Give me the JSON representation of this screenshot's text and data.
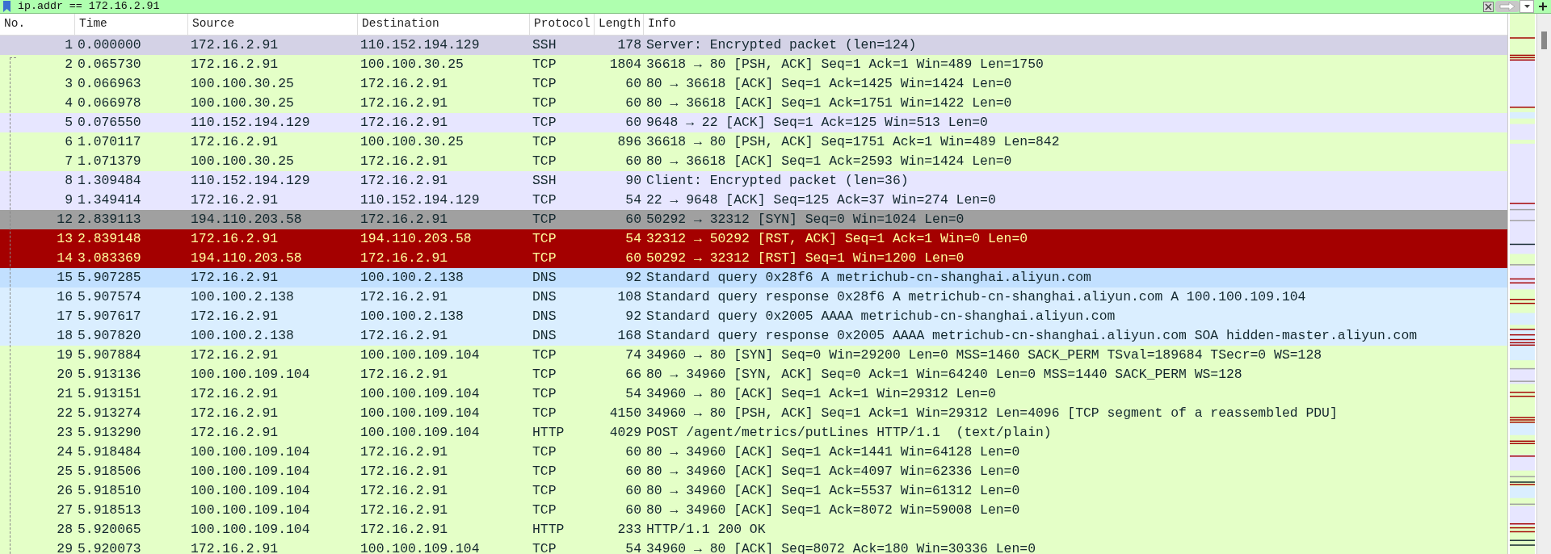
{
  "filter": {
    "value": "ip.addr == 172.16.2.91"
  },
  "columns": [
    "No.",
    "Time",
    "Source",
    "Destination",
    "Protocol",
    "Length",
    "Info"
  ],
  "packets": [
    {
      "no": "1",
      "time": "0.000000",
      "source": "172.16.2.91",
      "destination": "110.152.194.129",
      "protocol": "SSH",
      "length": "178",
      "info": "Server: Encrypted packet (len=124)",
      "kind": "ssh",
      "selected": true,
      "hovered": false
    },
    {
      "no": "2",
      "time": "0.065730",
      "source": "172.16.2.91",
      "destination": "100.100.30.25",
      "protocol": "TCP",
      "length": "1804",
      "info": "36618 → 80 [PSH, ACK] Seq=1 Ack=1 Win=489 Len=1750",
      "kind": "tcp",
      "selected": false,
      "hovered": false
    },
    {
      "no": "3",
      "time": "0.066963",
      "source": "100.100.30.25",
      "destination": "172.16.2.91",
      "protocol": "TCP",
      "length": "60",
      "info": "80 → 36618 [ACK] Seq=1 Ack=1425 Win=1424 Len=0",
      "kind": "tcp",
      "selected": false,
      "hovered": false
    },
    {
      "no": "4",
      "time": "0.066978",
      "source": "100.100.30.25",
      "destination": "172.16.2.91",
      "protocol": "TCP",
      "length": "60",
      "info": "80 → 36618 [ACK] Seq=1 Ack=1751 Win=1422 Len=0",
      "kind": "tcp",
      "selected": false,
      "hovered": false
    },
    {
      "no": "5",
      "time": "0.076550",
      "source": "110.152.194.129",
      "destination": "172.16.2.91",
      "protocol": "TCP",
      "length": "60",
      "info": "9648 → 22 [ACK] Seq=1 Ack=125 Win=513 Len=0",
      "kind": "ssh",
      "selected": false,
      "hovered": false
    },
    {
      "no": "6",
      "time": "1.070117",
      "source": "172.16.2.91",
      "destination": "100.100.30.25",
      "protocol": "TCP",
      "length": "896",
      "info": "36618 → 80 [PSH, ACK] Seq=1751 Ack=1 Win=489 Len=842",
      "kind": "tcp",
      "selected": false,
      "hovered": false
    },
    {
      "no": "7",
      "time": "1.071379",
      "source": "100.100.30.25",
      "destination": "172.16.2.91",
      "protocol": "TCP",
      "length": "60",
      "info": "80 → 36618 [ACK] Seq=1 Ack=2593 Win=1424 Len=0",
      "kind": "tcp",
      "selected": false,
      "hovered": false
    },
    {
      "no": "8",
      "time": "1.309484",
      "source": "110.152.194.129",
      "destination": "172.16.2.91",
      "protocol": "SSH",
      "length": "90",
      "info": "Client: Encrypted packet (len=36)",
      "kind": "ssh",
      "selected": false,
      "hovered": false
    },
    {
      "no": "9",
      "time": "1.349414",
      "source": "172.16.2.91",
      "destination": "110.152.194.129",
      "protocol": "TCP",
      "length": "54",
      "info": "22 → 9648 [ACK] Seq=125 Ack=37 Win=274 Len=0",
      "kind": "ssh",
      "selected": false,
      "hovered": false
    },
    {
      "no": "12",
      "time": "2.839113",
      "source": "194.110.203.58",
      "destination": "172.16.2.91",
      "protocol": "TCP",
      "length": "60",
      "info": "50292 → 32312 [SYN] Seq=0 Win=1024 Len=0",
      "kind": "syn",
      "selected": false,
      "hovered": false
    },
    {
      "no": "13",
      "time": "2.839148",
      "source": "172.16.2.91",
      "destination": "194.110.203.58",
      "protocol": "TCP",
      "length": "54",
      "info": "32312 → 50292 [RST, ACK] Seq=1 Ack=1 Win=0 Len=0",
      "kind": "rst",
      "selected": false,
      "hovered": false
    },
    {
      "no": "14",
      "time": "3.083369",
      "source": "194.110.203.58",
      "destination": "172.16.2.91",
      "protocol": "TCP",
      "length": "60",
      "info": "50292 → 32312 [RST] Seq=1 Win=1200 Len=0",
      "kind": "rst",
      "selected": false,
      "hovered": false
    },
    {
      "no": "15",
      "time": "5.907285",
      "source": "172.16.2.91",
      "destination": "100.100.2.138",
      "protocol": "DNS",
      "length": "92",
      "info": "Standard query 0x28f6 A metrichub-cn-shanghai.aliyun.com",
      "kind": "dns",
      "selected": false,
      "hovered": true
    },
    {
      "no": "16",
      "time": "5.907574",
      "source": "100.100.2.138",
      "destination": "172.16.2.91",
      "protocol": "DNS",
      "length": "108",
      "info": "Standard query response 0x28f6 A metrichub-cn-shanghai.aliyun.com A 100.100.109.104",
      "kind": "dns",
      "selected": false,
      "hovered": false
    },
    {
      "no": "17",
      "time": "5.907617",
      "source": "172.16.2.91",
      "destination": "100.100.2.138",
      "protocol": "DNS",
      "length": "92",
      "info": "Standard query 0x2005 AAAA metrichub-cn-shanghai.aliyun.com",
      "kind": "dns",
      "selected": false,
      "hovered": false
    },
    {
      "no": "18",
      "time": "5.907820",
      "source": "100.100.2.138",
      "destination": "172.16.2.91",
      "protocol": "DNS",
      "length": "168",
      "info": "Standard query response 0x2005 AAAA metrichub-cn-shanghai.aliyun.com SOA hidden-master.aliyun.com",
      "kind": "dns",
      "selected": false,
      "hovered": false
    },
    {
      "no": "19",
      "time": "5.907884",
      "source": "172.16.2.91",
      "destination": "100.100.109.104",
      "protocol": "TCP",
      "length": "74",
      "info": "34960 → 80 [SYN] Seq=0 Win=29200 Len=0 MSS=1460 SACK_PERM TSval=189684 TSecr=0 WS=128",
      "kind": "tcp",
      "selected": false,
      "hovered": false
    },
    {
      "no": "20",
      "time": "5.913136",
      "source": "100.100.109.104",
      "destination": "172.16.2.91",
      "protocol": "TCP",
      "length": "66",
      "info": "80 → 34960 [SYN, ACK] Seq=0 Ack=1 Win=64240 Len=0 MSS=1440 SACK_PERM WS=128",
      "kind": "tcp",
      "selected": false,
      "hovered": false
    },
    {
      "no": "21",
      "time": "5.913151",
      "source": "172.16.2.91",
      "destination": "100.100.109.104",
      "protocol": "TCP",
      "length": "54",
      "info": "34960 → 80 [ACK] Seq=1 Ack=1 Win=29312 Len=0",
      "kind": "tcp",
      "selected": false,
      "hovered": false
    },
    {
      "no": "22",
      "time": "5.913274",
      "source": "172.16.2.91",
      "destination": "100.100.109.104",
      "protocol": "TCP",
      "length": "4150",
      "info": "34960 → 80 [PSH, ACK] Seq=1 Ack=1 Win=29312 Len=4096 [TCP segment of a reassembled PDU]",
      "kind": "tcp",
      "selected": false,
      "hovered": false
    },
    {
      "no": "23",
      "time": "5.913290",
      "source": "172.16.2.91",
      "destination": "100.100.109.104",
      "protocol": "HTTP",
      "length": "4029",
      "info": "POST /agent/metrics/putLines HTTP/1.1  (text/plain)",
      "kind": "tcp",
      "selected": false,
      "hovered": false
    },
    {
      "no": "24",
      "time": "5.918484",
      "source": "100.100.109.104",
      "destination": "172.16.2.91",
      "protocol": "TCP",
      "length": "60",
      "info": "80 → 34960 [ACK] Seq=1 Ack=1441 Win=64128 Len=0",
      "kind": "tcp",
      "selected": false,
      "hovered": false
    },
    {
      "no": "25",
      "time": "5.918506",
      "source": "100.100.109.104",
      "destination": "172.16.2.91",
      "protocol": "TCP",
      "length": "60",
      "info": "80 → 34960 [ACK] Seq=1 Ack=4097 Win=62336 Len=0",
      "kind": "tcp",
      "selected": false,
      "hovered": false
    },
    {
      "no": "26",
      "time": "5.918510",
      "source": "100.100.109.104",
      "destination": "172.16.2.91",
      "protocol": "TCP",
      "length": "60",
      "info": "80 → 34960 [ACK] Seq=1 Ack=5537 Win=61312 Len=0",
      "kind": "tcp",
      "selected": false,
      "hovered": false
    },
    {
      "no": "27",
      "time": "5.918513",
      "source": "100.100.109.104",
      "destination": "172.16.2.91",
      "protocol": "TCP",
      "length": "60",
      "info": "80 → 34960 [ACK] Seq=1 Ack=8072 Win=59008 Len=0",
      "kind": "tcp",
      "selected": false,
      "hovered": false
    },
    {
      "no": "28",
      "time": "5.920065",
      "source": "100.100.109.104",
      "destination": "172.16.2.91",
      "protocol": "HTTP",
      "length": "233",
      "info": "HTTP/1.1 200 OK",
      "kind": "tcp",
      "selected": false,
      "hovered": false
    },
    {
      "no": "29",
      "time": "5.920073",
      "source": "172.16.2.91",
      "destination": "100.100.109.104",
      "protocol": "TCP",
      "length": "54",
      "info": "34960 → 80 [ACK] Seq=8072 Ack=180 Win=30336 Len=0",
      "kind": "tcp",
      "selected": false,
      "hovered": false
    }
  ]
}
